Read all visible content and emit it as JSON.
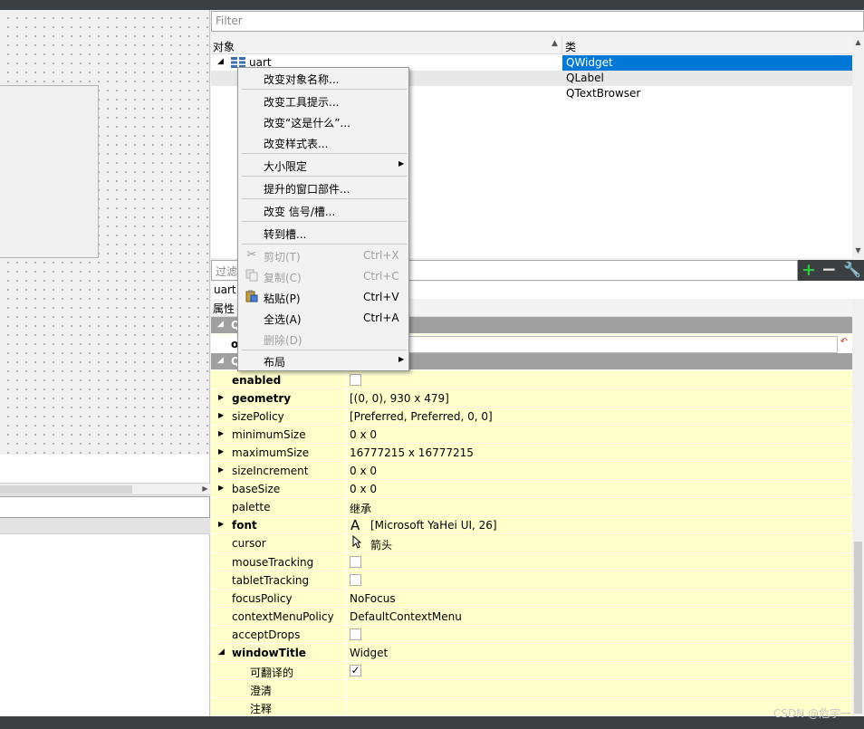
{
  "filter_placeholder": "Filter",
  "object_inspector": {
    "header_object": "对象",
    "header_class": "类",
    "rows": [
      {
        "name": "uart",
        "class": "QWidget"
      },
      {
        "name": "",
        "class": "QLabel"
      },
      {
        "name": "",
        "class": "QTextBrowser"
      }
    ]
  },
  "property_editor": {
    "filter_placeholder": "过滤",
    "object_name": "uart",
    "header_property": "属性",
    "groups": [
      "Q",
      "Q"
    ],
    "rows": [
      {
        "name": "enabled",
        "value": "",
        "type": "checkbox",
        "checked": false,
        "bold": true,
        "expandable": false
      },
      {
        "name": "geometry",
        "value": "[(0, 0), 930 x 479]",
        "bold": true,
        "expandable": true
      },
      {
        "name": "sizePolicy",
        "value": "[Preferred, Preferred, 0, 0]",
        "expandable": true
      },
      {
        "name": "minimumSize",
        "value": "0 x 0",
        "expandable": true
      },
      {
        "name": "maximumSize",
        "value": "16777215 x 16777215",
        "expandable": true
      },
      {
        "name": "sizeIncrement",
        "value": "0 x 0",
        "expandable": true
      },
      {
        "name": "baseSize",
        "value": "0 x 0",
        "expandable": true
      },
      {
        "name": "palette",
        "value": "继承"
      },
      {
        "name": "font",
        "value": "[Microsoft YaHei UI, 26]",
        "bold": true,
        "expandable": true,
        "icon": "font-A-icon"
      },
      {
        "name": "cursor",
        "value": "箭头",
        "icon": "arrow-cursor-icon"
      },
      {
        "name": "mouseTracking",
        "value": "",
        "type": "checkbox",
        "checked": false
      },
      {
        "name": "tabletTracking",
        "value": "",
        "type": "checkbox",
        "checked": false
      },
      {
        "name": "focusPolicy",
        "value": "NoFocus"
      },
      {
        "name": "contextMenuPolicy",
        "value": "DefaultContextMenu"
      },
      {
        "name": "acceptDrops",
        "value": "",
        "type": "checkbox",
        "checked": false
      },
      {
        "name": "windowTitle",
        "value": "Widget",
        "bold": true,
        "expanded": true
      },
      {
        "name": "可翻译的",
        "value": "✓",
        "type": "checkbox",
        "checked": true,
        "sub": true
      },
      {
        "name": "澄清",
        "value": "",
        "sub": true
      },
      {
        "name": "注释",
        "value": "",
        "sub": true
      }
    ]
  },
  "context_menu": {
    "items": [
      {
        "label": "改变对象名称..."
      },
      {
        "label": "改变工具提示..."
      },
      {
        "label": "改变“这是什么”..."
      },
      {
        "label": "改变样式表..."
      },
      {
        "label": "大小限定",
        "submenu": true
      },
      {
        "label": "提升的窗口部件..."
      },
      {
        "label": "改变 信号/槽..."
      },
      {
        "label": "转到槽..."
      },
      {
        "label": "剪切(T)",
        "shortcut": "Ctrl+X",
        "disabled": true,
        "icon": "scissors-icon"
      },
      {
        "label": "复制(C)",
        "shortcut": "Ctrl+C",
        "disabled": true,
        "icon": "copy-icon"
      },
      {
        "label": "粘贴(P)",
        "shortcut": "Ctrl+V",
        "icon": "paste-icon"
      },
      {
        "label": "全选(A)",
        "shortcut": "Ctrl+A"
      },
      {
        "label": "删除(D)",
        "disabled": true
      },
      {
        "label": "布局",
        "submenu": true
      }
    ]
  },
  "watermark": "CSDN @危宇一",
  "colors": {
    "selection": "#0078d7",
    "property_bg": "#ffffcc",
    "group_bg": "#a0a0a0",
    "dark_bar": "#3c3f41"
  }
}
